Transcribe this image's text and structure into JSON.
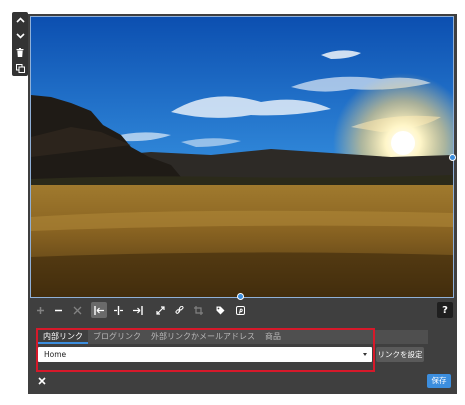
{
  "side_toolbar": {
    "icons": [
      "chevron-up",
      "chevron-down",
      "trash",
      "duplicate"
    ]
  },
  "toolbar": {
    "buttons": [
      {
        "name": "zoom-in",
        "state": "disabled"
      },
      {
        "name": "zoom-out",
        "state": "enabled"
      },
      {
        "name": "fit",
        "state": "disabled"
      },
      {
        "name": "align-left",
        "state": "active"
      },
      {
        "name": "align-center",
        "state": "enabled"
      },
      {
        "name": "align-right",
        "state": "enabled"
      },
      {
        "name": "expand",
        "state": "enabled"
      },
      {
        "name": "link",
        "state": "enabled"
      },
      {
        "name": "crop",
        "state": "disabled"
      },
      {
        "name": "tag",
        "state": "enabled"
      },
      {
        "name": "pinterest",
        "state": "enabled"
      }
    ],
    "help_label": "?"
  },
  "link_panel": {
    "tabs": [
      {
        "label": "内部リンク",
        "active": true
      },
      {
        "label": "ブログリンク",
        "active": false
      },
      {
        "label": "外部リンクかメールアドレス",
        "active": false
      },
      {
        "label": "商品",
        "active": false
      }
    ],
    "select_value": "Home",
    "set_link_label": "リンクを設定",
    "highlight_color": "#d6192a"
  },
  "footer": {
    "close_label": "✕",
    "save_label": "保存"
  },
  "colors": {
    "accent": "#3c8ede",
    "panel_bg": "#3f3f3f",
    "toolbar_bg": "#333333"
  }
}
